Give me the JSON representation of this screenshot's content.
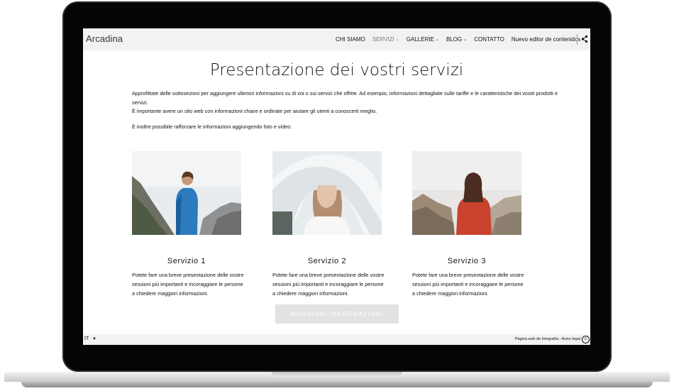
{
  "site": {
    "logo": "Arcadina",
    "nav": [
      {
        "label": "CHI SIAMO",
        "dropdown": false,
        "active": false
      },
      {
        "label": "SERVIZI",
        "dropdown": true,
        "active": true
      },
      {
        "label": "GALLERIE",
        "dropdown": true,
        "active": false
      },
      {
        "label": "BLOG",
        "dropdown": true,
        "active": false
      },
      {
        "label": "CONTATTO",
        "dropdown": false,
        "active": false
      },
      {
        "label": "Nuevo editor de contenidos",
        "dropdown": false,
        "active": false
      }
    ],
    "share_icon": "share-icon"
  },
  "main": {
    "title": "Presentazione dei vostri servizi",
    "intro": [
      "Approfittate delle sottosezioni per aggiungere ulteriori informazioni su di voi o sui servizi che offrite. Ad esempio, informazioni dettagliate sulle tariffe e le caratteristiche dei vostri prodotti e servizi.",
      "È importante avere un sito web con informazioni chiare e ordinate per aiutare gli utenti a conoscerti meglio.",
      "È inoltre possibile rafforzare le informazioni aggiungendo foto e video."
    ],
    "services": [
      {
        "title": "Servizio 1",
        "text": "Potete fare una breve presentazione delle vostre sessioni più importanti e incoraggiare le persone a chiedere maggiori informazioni."
      },
      {
        "title": "Servizio 2",
        "text": "Potete fare una breve presentazione delle vostre sessioni più importanti e incoraggiare le persone a chiedere maggiori informazioni."
      },
      {
        "title": "Servizio 3",
        "text": "Potete fare una breve presentazione delle vostre sessioni più importanti e incoraggiare le persone a chiedere maggiori informazioni."
      }
    ],
    "more_button": "MAGGIORI INFORMAZIONI"
  },
  "footer": {
    "language": "IT",
    "links": "Pàgina web de fotografía - Aviso legal",
    "copyright_icon": "copyright-icon"
  },
  "colors": {
    "topbar_bg": "#f2f2f2",
    "button_bg": "#e2e2e2",
    "text": "#111111"
  }
}
